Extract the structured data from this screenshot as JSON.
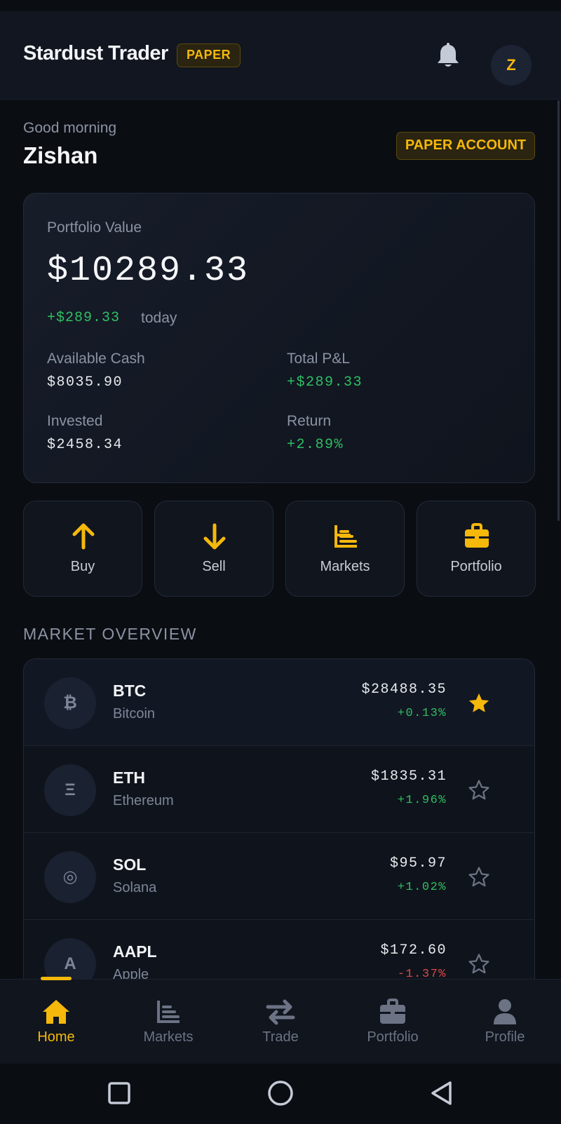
{
  "header": {
    "app_title": "Stardust Trader",
    "mode_chip": "PAPER",
    "avatar_initial": "Z"
  },
  "greeting": {
    "salutation": "Good morning",
    "name": "Zishan",
    "account_badge": "PAPER ACCOUNT"
  },
  "portfolio": {
    "label": "Portfolio Value",
    "value": "$10289.33",
    "change": "+$289.33",
    "change_suffix": "today",
    "available_cash_label": "Available Cash",
    "available_cash": "$8035.90",
    "total_pl_label": "Total P&L",
    "total_pl": "+$289.33",
    "invested_label": "Invested",
    "invested": "$2458.34",
    "return_label": "Return",
    "return_value": "+2.89%"
  },
  "quick_actions": [
    {
      "label": "Buy",
      "icon": "arrow-up-icon"
    },
    {
      "label": "Sell",
      "icon": "arrow-down-icon"
    },
    {
      "label": "Markets",
      "icon": "chart-bars-icon"
    },
    {
      "label": "Portfolio",
      "icon": "briefcase-icon"
    }
  ],
  "market_overview": {
    "title": "MARKET OVERVIEW",
    "items": [
      {
        "symbol": "BTC",
        "name": "Bitcoin",
        "logo": "₿",
        "price": "$28488.35",
        "change": "+0.13%",
        "direction": "up",
        "starred": true
      },
      {
        "symbol": "ETH",
        "name": "Ethereum",
        "logo": "Ξ",
        "price": "$1835.31",
        "change": "+1.96%",
        "direction": "up",
        "starred": false
      },
      {
        "symbol": "SOL",
        "name": "Solana",
        "logo": "◎",
        "price": "$95.97",
        "change": "+1.02%",
        "direction": "up",
        "starred": false
      },
      {
        "symbol": "AAPL",
        "name": "Apple",
        "logo": "A",
        "price": "$172.60",
        "change": "-1.37%",
        "direction": "down",
        "starred": false
      }
    ]
  },
  "bottom_nav": {
    "active": "Home",
    "items": [
      {
        "label": "Home",
        "icon": "home-icon"
      },
      {
        "label": "Markets",
        "icon": "chart-bars-icon"
      },
      {
        "label": "Trade",
        "icon": "swap-arrows-icon"
      },
      {
        "label": "Portfolio",
        "icon": "briefcase-icon"
      },
      {
        "label": "Profile",
        "icon": "person-icon"
      }
    ]
  },
  "colors": {
    "accent": "#f5b80b",
    "positive": "#2fbf62",
    "negative": "#e04646",
    "background": "#0a0d12"
  }
}
